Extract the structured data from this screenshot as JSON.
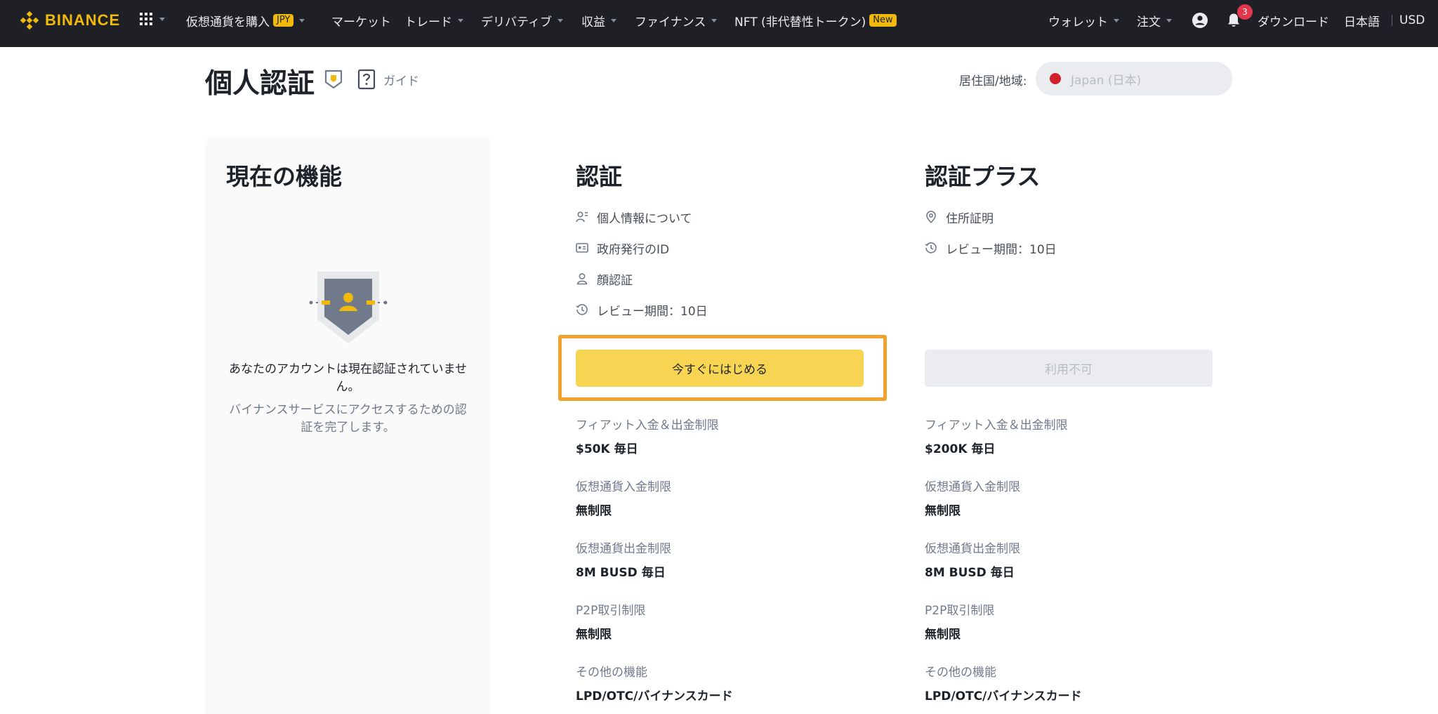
{
  "nav": {
    "brand": "BINANCE",
    "buy_crypto": "仮想通貨を購入",
    "currency_pill": "JPY",
    "markets": "マーケット",
    "trade": "トレード",
    "derivatives": "デリバティブ",
    "earn": "収益",
    "finance": "ファイナンス",
    "nft": "NFT (非代替性トークン)",
    "new_pill": "New",
    "wallet": "ウォレット",
    "orders": "注文",
    "notification_count": "3",
    "download": "ダウンロード",
    "language": "日本語",
    "fiat": "USD"
  },
  "header": {
    "title": "個人認証",
    "guide": "ガイド",
    "region_label": "居住国/地域:",
    "region_value": "Japan (日本)"
  },
  "current": {
    "title": "現在の機能",
    "message": "あなたのアカウントは現在認証されていません。",
    "sub": "バイナンスサービスにアクセスするための認証を完了します。"
  },
  "verified": {
    "title": "認証",
    "requirements": [
      {
        "icon": "personal-info-icon",
        "label": "個人情報について"
      },
      {
        "icon": "id-card-icon",
        "label": "政府発行のID"
      },
      {
        "icon": "face-icon",
        "label": "顔認証"
      },
      {
        "icon": "clock-icon",
        "label": "レビュー期間：10日"
      }
    ],
    "button": "今すぐにはじめる",
    "limits": [
      {
        "label": "フィアット入金＆出金制限",
        "value": "$50K 毎日"
      },
      {
        "label": "仮想通貨入金制限",
        "value": "無制限"
      },
      {
        "label": "仮想通貨出金制限",
        "value": "8M BUSD 毎日"
      },
      {
        "label": "P2P取引制限",
        "value": "無制限"
      },
      {
        "label": "その他の機能",
        "value": "LPD/OTC/バイナンスカード"
      }
    ]
  },
  "plus": {
    "title": "認証プラス",
    "requirements": [
      {
        "icon": "location-icon",
        "label": "住所証明"
      },
      {
        "icon": "clock-icon",
        "label": "レビュー期間：10日"
      }
    ],
    "button": "利用不可",
    "limits": [
      {
        "label": "フィアット入金＆出金制限",
        "value": "$200K 毎日"
      },
      {
        "label": "仮想通貨入金制限",
        "value": "無制限"
      },
      {
        "label": "仮想通貨出金制限",
        "value": "8M BUSD 毎日"
      },
      {
        "label": "P2P取引制限",
        "value": "無制限"
      },
      {
        "label": "その他の機能",
        "value": "LPD/OTC/バイナンスカード"
      }
    ]
  },
  "colors": {
    "brand": "#f0b90b",
    "nav_bg": "#1e2026",
    "primary_button": "#f7d552",
    "highlight_border": "#f0a32d",
    "notification": "#e0374c"
  }
}
